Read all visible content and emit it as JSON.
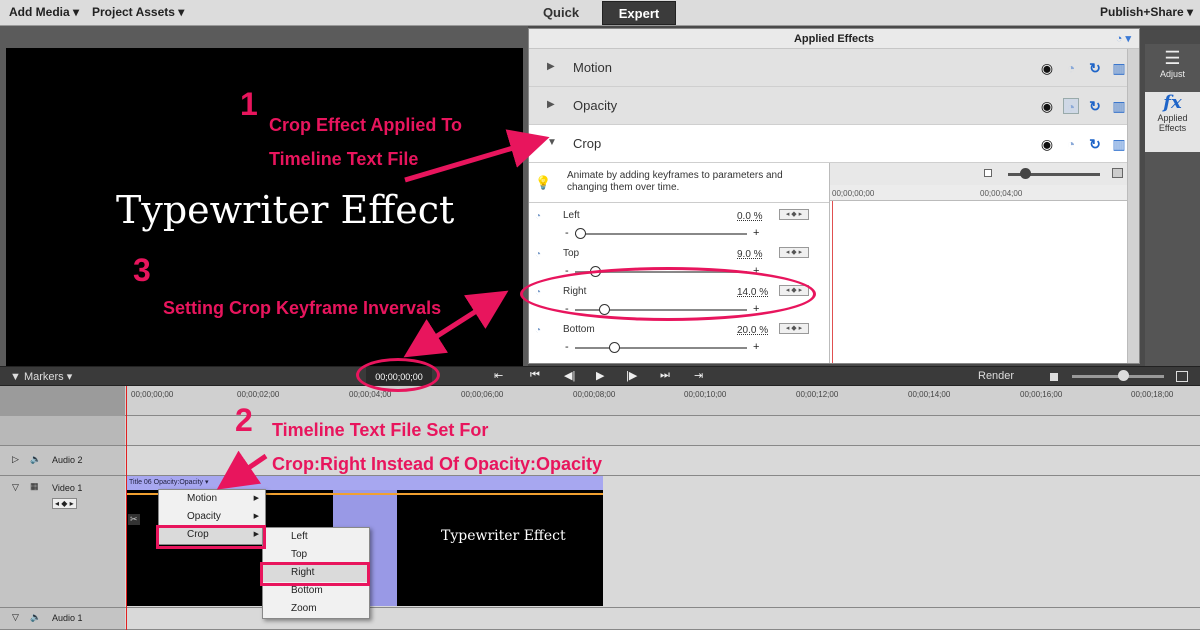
{
  "topbar": {
    "add_media": "Add Media ▾",
    "project_assets": "Project Assets ▾",
    "mode_quick": "Quick",
    "mode_expert": "Expert",
    "publish": "Publish+Share ▾"
  },
  "monitor": {
    "title_text": "Typewriter Effect"
  },
  "effects_panel": {
    "header": "Applied Effects",
    "effects": [
      {
        "name": "Motion"
      },
      {
        "name": "Opacity"
      },
      {
        "name": "Crop"
      }
    ],
    "hint": "Animate by adding keyframes to parameters and changing them over time.",
    "params": [
      {
        "label": "Left",
        "value": "0.0 %",
        "percent": 0
      },
      {
        "label": "Top",
        "value": "9.0 %",
        "percent": 9
      },
      {
        "label": "Right",
        "value": "14.0 %",
        "percent": 14
      },
      {
        "label": "Bottom",
        "value": "20.0 %",
        "percent": 20
      }
    ],
    "kf_ruler": [
      "00;00;00;00",
      "00;00;04;00"
    ],
    "minus": "-",
    "plus": "+"
  },
  "sidebar": {
    "adjust": "Adjust",
    "applied_effects": "Applied Effects"
  },
  "transport": {
    "markers": "▼ Markers ▾",
    "timecode": "00;00;00;00",
    "render": "Render"
  },
  "timeline": {
    "ruler": [
      "00;00;00;00",
      "00;00;02;00",
      "00;00;04;00",
      "00;00;06;00",
      "00;00;08;00",
      "00;00;10;00",
      "00;00;12;00",
      "00;00;14;00",
      "00;00;16;00",
      "00;00;18;00"
    ],
    "tracks": {
      "audio2": "Audio 2",
      "video1": "Video 1",
      "audio1": "Audio 1"
    },
    "clip_label": "Title 06  Opacity:Opacity ▾",
    "clip_text": "Typewriter Effect"
  },
  "context_menu": {
    "main": [
      "Motion",
      "Opacity",
      "Crop"
    ],
    "sub": [
      "Left",
      "Top",
      "Right",
      "Bottom",
      "Zoom"
    ]
  },
  "annotations": {
    "n1": "1",
    "t1a": "Crop Effect Applied To",
    "t1b": "Timeline Text File",
    "n3": "3",
    "t3": "Setting Crop Keyframe Invervals",
    "n2": "2",
    "t2a": "Timeline Text File Set For",
    "t2b": "Crop:Right Instead Of Opacity:Opacity",
    "color": "#e8155d"
  }
}
